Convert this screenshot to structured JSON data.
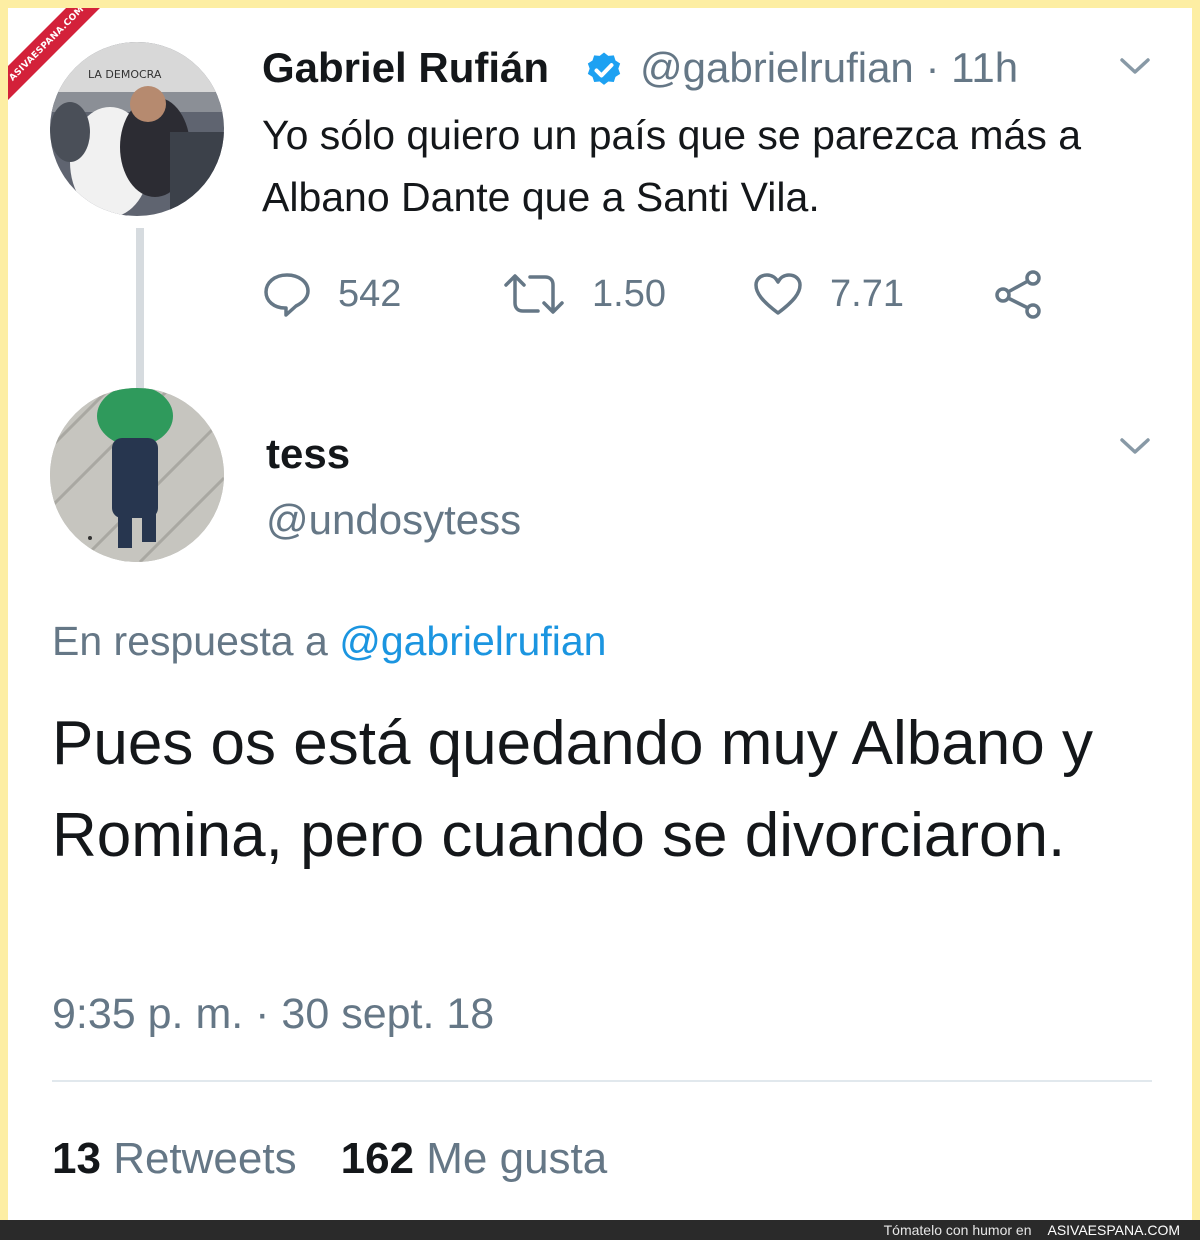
{
  "watermark": {
    "ribbon_text": "ASIVAESPANA.COM"
  },
  "tweet_original": {
    "avatar_sign_text": "LA DEMOCRA",
    "author_name": "Gabriel Rufián",
    "handle": "@gabrielrufian",
    "separator": "·",
    "age": "11h",
    "text": "Yo sólo quiero un país que se parezca más a Albano Dante que a Santi Vila.",
    "replies": "542",
    "retweets": "1.50",
    "likes": "7.71"
  },
  "tweet_reply": {
    "author_name": "tess",
    "handle": "@undosytess",
    "reply_prefix": "En respuesta a",
    "reply_to": "@gabrielrufian",
    "text": "Pues os está quedando muy Albano y Romina, pero cuando se divorciaron.",
    "timestamp": "9:35 p. m. · 30 sept. 18",
    "retweet_count": "13",
    "retweet_label": "Retweets",
    "like_count": "162",
    "like_label": "Me gusta"
  },
  "footer": {
    "text": "Tómatelo con humor en",
    "brand": "ASIVAESPANA.COM"
  },
  "colors": {
    "background_frame": "#fdeea3",
    "text_primary": "#14171a",
    "text_secondary": "#657786",
    "link": "#1b95e0",
    "verified": "#1da1f2",
    "ribbon": "#d3213a"
  },
  "icons": [
    "verified-badge-icon",
    "chevron-down-icon",
    "reply-icon",
    "retweet-icon",
    "like-icon",
    "share-icon"
  ]
}
